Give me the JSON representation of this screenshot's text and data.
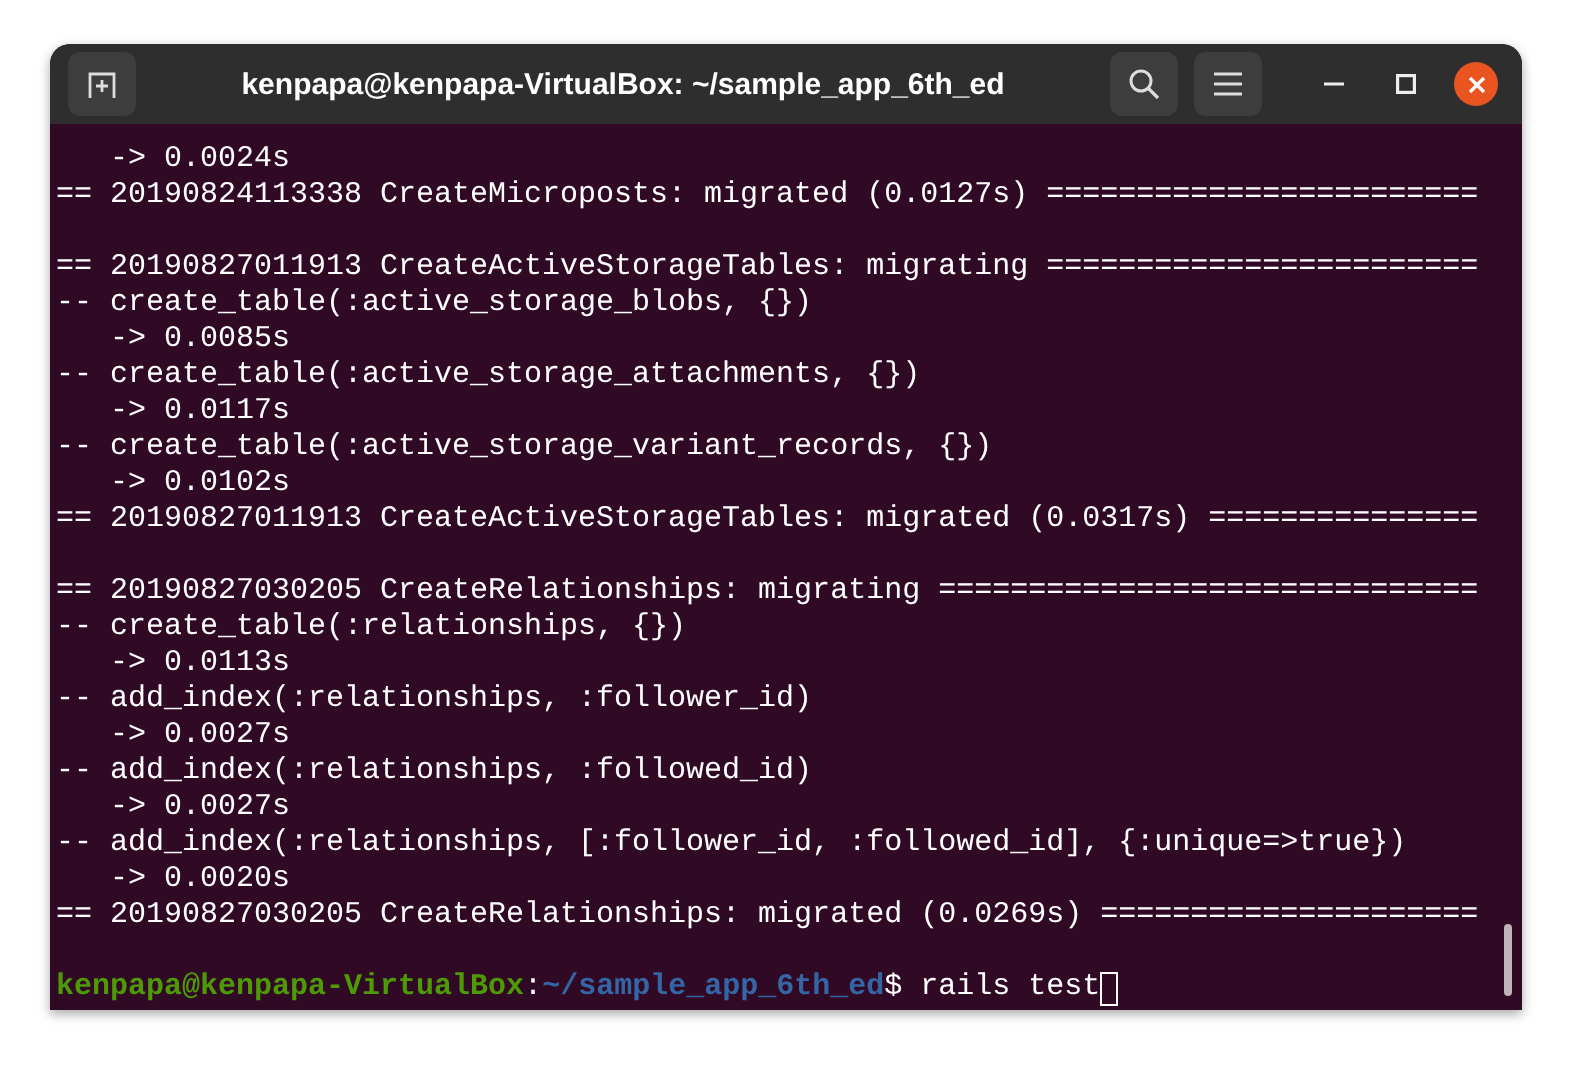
{
  "window": {
    "title": "kenpapa@kenpapa-VirtualBox: ~/sample_app_6th_ed"
  },
  "output_blocks": [
    {
      "lines": [
        "   -> 0.0024s",
        "== 20190824113338 CreateMicroposts: migrated (0.0127s) ========================"
      ]
    },
    {
      "lines": [
        "== 20190827011913 CreateActiveStorageTables: migrating ========================",
        "-- create_table(:active_storage_blobs, {})",
        "   -> 0.0085s",
        "-- create_table(:active_storage_attachments, {})",
        "   -> 0.0117s",
        "-- create_table(:active_storage_variant_records, {})",
        "   -> 0.0102s",
        "== 20190827011913 CreateActiveStorageTables: migrated (0.0317s) ==============="
      ]
    },
    {
      "lines": [
        "== 20190827030205 CreateRelationships: migrating ==============================",
        "-- create_table(:relationships, {})",
        "   -> 0.0113s",
        "-- add_index(:relationships, :follower_id)",
        "   -> 0.0027s",
        "-- add_index(:relationships, :followed_id)",
        "   -> 0.0027s",
        "-- add_index(:relationships, [:follower_id, :followed_id], {:unique=>true})",
        "   -> 0.0020s",
        "== 20190827030205 CreateRelationships: migrated (0.0269s) ====================="
      ]
    }
  ],
  "prompt": {
    "user_host": "kenpapa@kenpapa-VirtualBox",
    "separator": ":",
    "path": "~/sample_app_6th_ed",
    "symbol": "$",
    "command": " rails test"
  }
}
